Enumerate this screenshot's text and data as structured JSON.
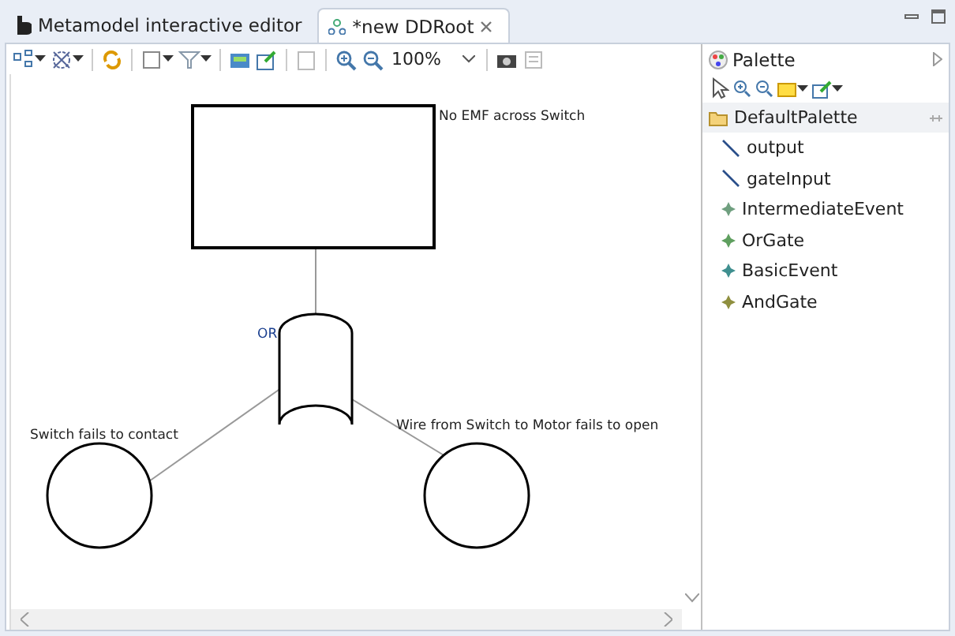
{
  "tabs": [
    {
      "label": "Metamodel interactive editor",
      "kind": "editor",
      "selected": false
    },
    {
      "label": "*new DDRoot",
      "kind": "diagram",
      "selected": true
    }
  ],
  "toolbar": {
    "zoom": "100%"
  },
  "diagram": {
    "nodes": [
      {
        "kind": "event",
        "label": "No EMF across Switch"
      },
      {
        "kind": "gate",
        "label": "OR"
      },
      {
        "kind": "basic",
        "label": "Switch fails to contact"
      },
      {
        "kind": "basic",
        "label": "Wire from Switch to Motor fails to open"
      }
    ]
  },
  "palette": {
    "title": "Palette",
    "drawer": "DefaultPalette",
    "items": [
      {
        "kind": "connection",
        "label": "output"
      },
      {
        "kind": "connection",
        "label": "gateInput"
      },
      {
        "kind": "node",
        "label": "IntermediateEvent",
        "color": "#6f9f7f"
      },
      {
        "kind": "node",
        "label": "OrGate",
        "color": "#5f9f5f"
      },
      {
        "kind": "node",
        "label": "BasicEvent",
        "color": "#3f8f8f"
      },
      {
        "kind": "node",
        "label": "AndGate",
        "color": "#8f8f3f"
      }
    ]
  }
}
